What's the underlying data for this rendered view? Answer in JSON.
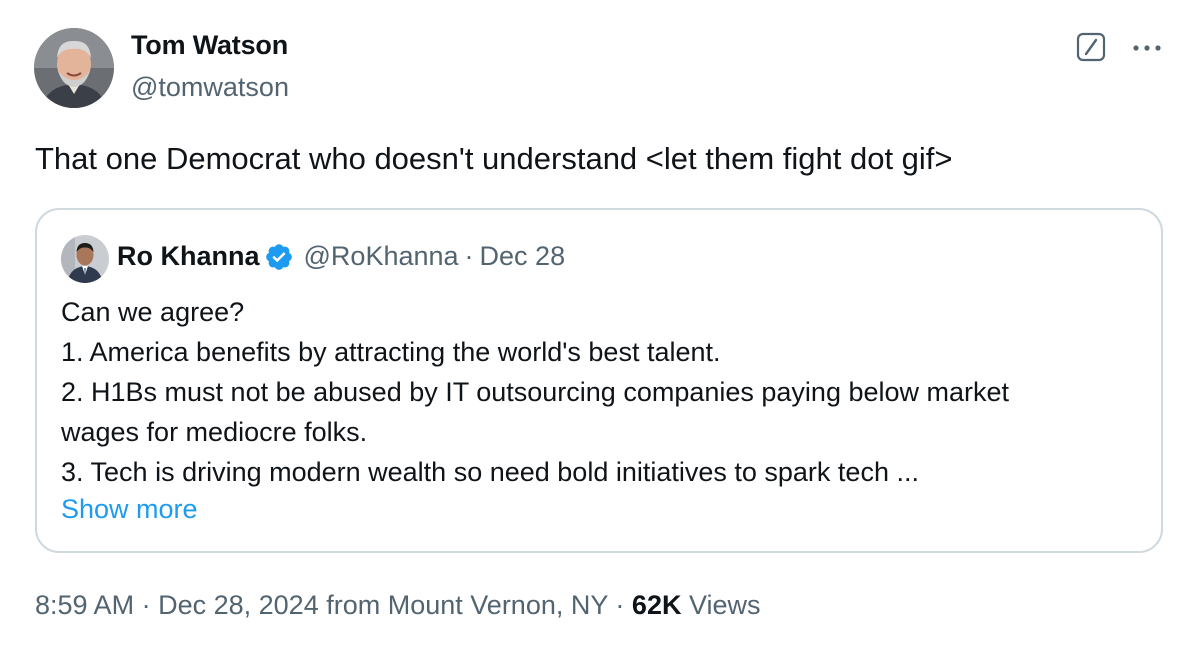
{
  "author": {
    "name": "Tom Watson",
    "handle": "@tomwatson"
  },
  "tweet": {
    "text": "That one Democrat who doesn't understand <let them fight dot gif>"
  },
  "quote": {
    "name": "Ro Khanna",
    "handle": "@RoKhanna",
    "separator": "·",
    "date": "Dec 28",
    "lines": [
      "Can we agree?",
      "1. America benefits by attracting the world's best talent.",
      "2. H1Bs must not be abused by IT outsourcing companies paying below market",
      "wages for mediocre folks.",
      "3. Tech is driving modern wealth so need bold initiatives to spark tech ..."
    ],
    "show_more": "Show more"
  },
  "meta": {
    "time": "8:59 AM",
    "sep1": "·",
    "date": "Dec 28, 2024",
    "location": "from Mount Vernon, NY",
    "sep2": "·",
    "views_count": "62K",
    "views_label": "Views"
  },
  "icons": {
    "grok": "grok-icon",
    "more": "more-horizontal-icon",
    "verified": "verified-badge-icon"
  },
  "colors": {
    "text": "#0f1419",
    "secondary": "#536471",
    "link": "#1d9bf0",
    "border": "#cfd9de"
  }
}
